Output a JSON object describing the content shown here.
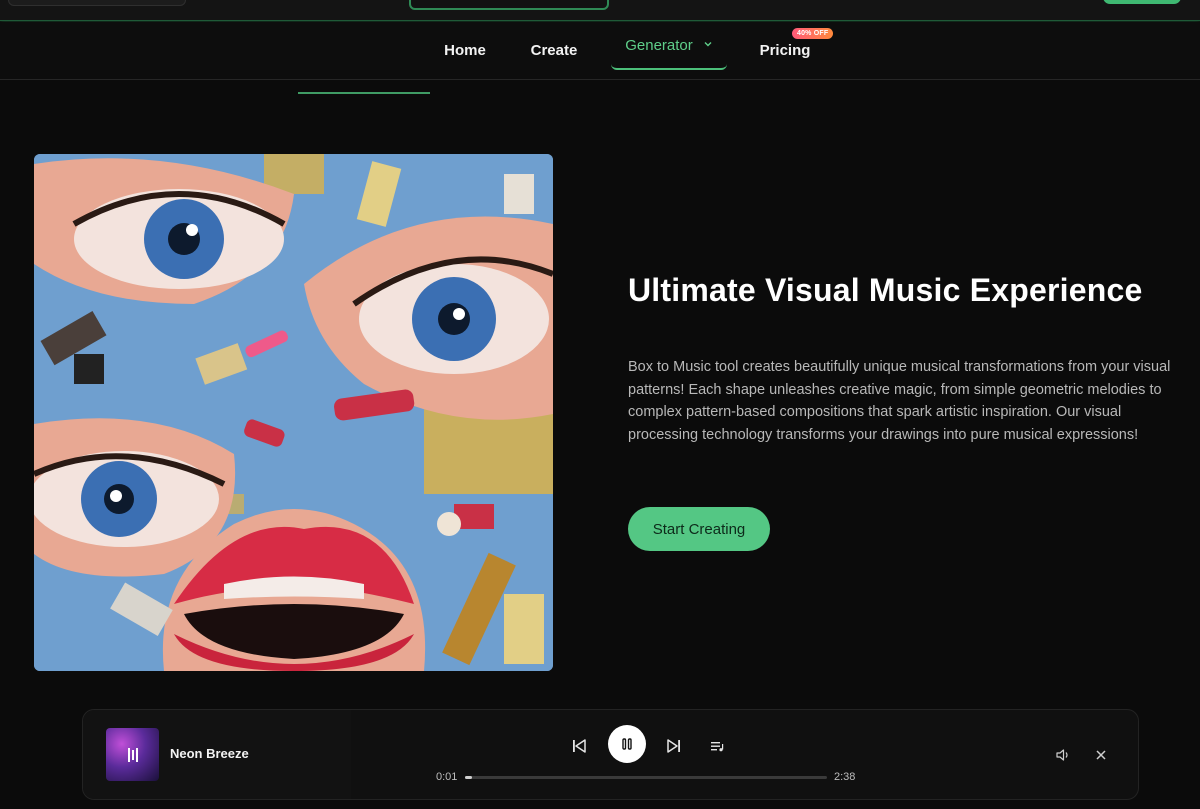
{
  "nav": {
    "items": [
      {
        "label": "Home"
      },
      {
        "label": "Create"
      },
      {
        "label": "Generator"
      },
      {
        "label": "Pricing"
      }
    ],
    "pricing_badge": "40% OFF"
  },
  "hero": {
    "title": "Ultimate Visual Music Experience",
    "description": "Box to Music tool creates beautifully unique musical transformations from your visual patterns! Each shape unleashes creative magic, from simple geometric melodies to complex pattern-based compositions that spark artistic inspiration. Our visual processing technology transforms your drawings into pure musical expressions!",
    "cta_label": "Start Creating"
  },
  "player": {
    "track_name": "Neon Breeze",
    "current_time": "0:01",
    "total_time": "2:38",
    "progress_fraction": 0.006
  },
  "colors": {
    "accent": "#54c784",
    "background": "#0b0b0b",
    "nav_active": "#5fcf8a"
  },
  "icons": {
    "prev": "skip-previous-icon",
    "play_pause": "pause-icon",
    "next": "skip-next-icon",
    "queue": "queue-icon",
    "volume": "volume-icon",
    "close": "close-icon",
    "dropdown": "chevron-down-icon"
  }
}
